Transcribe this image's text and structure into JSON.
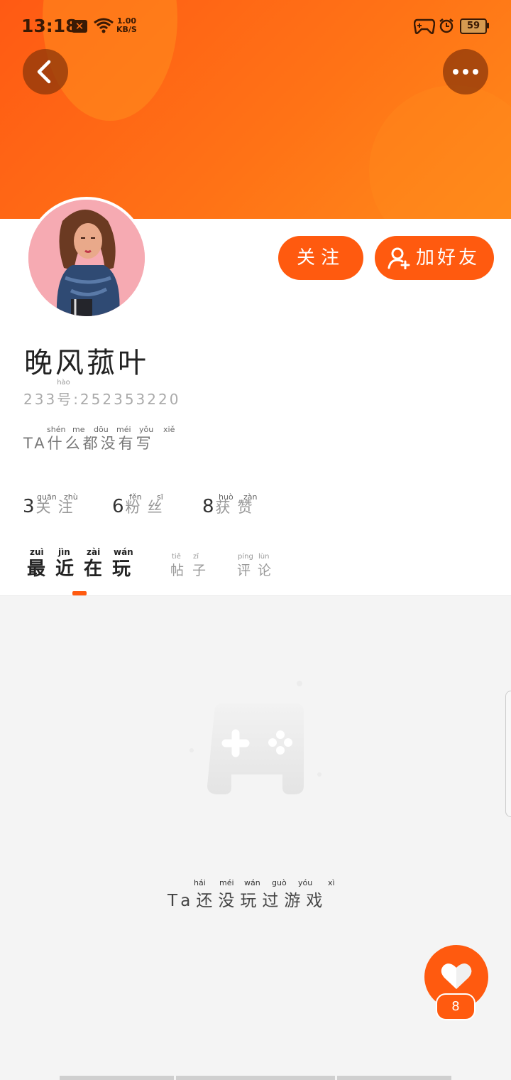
{
  "status_bar": {
    "time": "13:18",
    "net_speed_value": "1.00",
    "net_speed_unit": "KB/S",
    "battery": "59"
  },
  "header": {
    "back_icon": "chevron-left-icon",
    "more_icon": "more-dots-icon"
  },
  "profile": {
    "follow_label": "关注",
    "add_friend_label": "加好友",
    "name": "晚风菰叶",
    "uid_prefix": "233",
    "uid_hanzi": "号",
    "uid_pinyin": "hào",
    "uid_value": ":252353220",
    "bio_prefix": "TA",
    "bio_text": "什么都没有写",
    "bio_pinyin": [
      "shén",
      "me",
      "dōu",
      "méi",
      "yǒu",
      "xiě"
    ]
  },
  "stats": [
    {
      "value": "3",
      "label": "关注",
      "pinyin": [
        "guān",
        "zhù"
      ]
    },
    {
      "value": "6",
      "label": "粉丝",
      "pinyin": [
        "fěn",
        "sī"
      ]
    },
    {
      "value": "8",
      "label": "获赞",
      "pinyin": [
        "huò",
        "zàn"
      ]
    }
  ],
  "tabs": [
    {
      "label": "最近在玩",
      "pinyin": [
        "zuì",
        "jìn",
        "zài",
        "wán"
      ],
      "active": true
    },
    {
      "label": "帖子",
      "pinyin": [
        "tiě",
        "zǐ"
      ],
      "active": false
    },
    {
      "label": "评论",
      "pinyin": [
        "píng",
        "lùn"
      ],
      "active": false
    }
  ],
  "empty_state": {
    "icon": "gamepad-icon",
    "prefix": "Ta",
    "text": "还没玩过游戏",
    "pinyin": [
      "hái",
      "méi",
      "wán",
      "guò",
      "yóu",
      "xì"
    ]
  },
  "like": {
    "icon": "heart-icon",
    "count": "8"
  },
  "colors": {
    "accent": "#ff5a0f",
    "header_start": "#ff5a14",
    "header_end": "#ff8a1a"
  }
}
